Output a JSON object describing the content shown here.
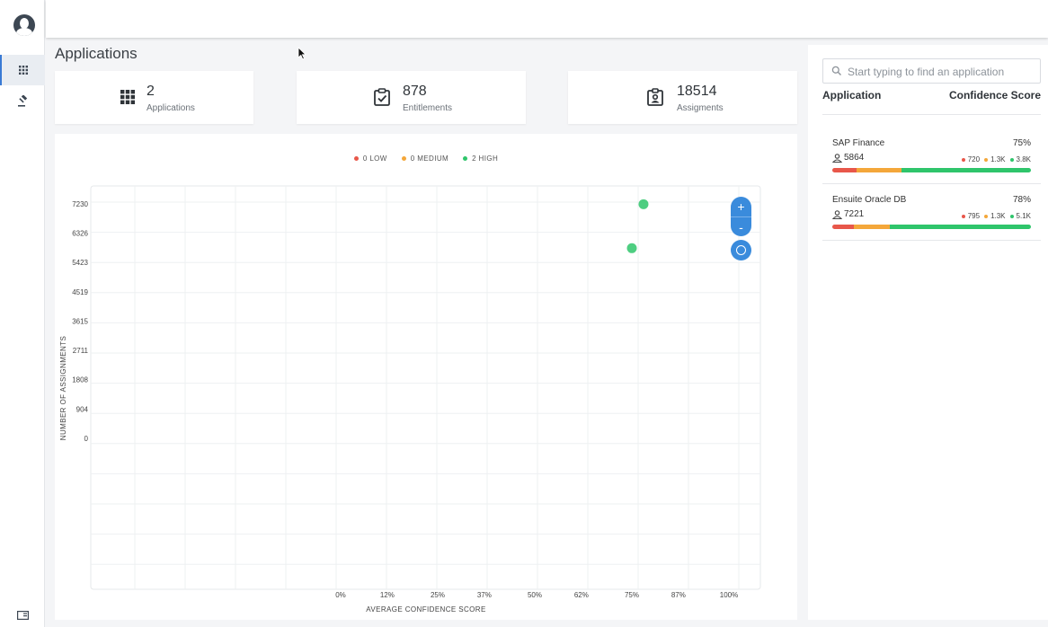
{
  "colors": {
    "low": "#e8574a",
    "medium": "#f4a73a",
    "high": "#2fc56b",
    "accent": "#3a8bdc"
  },
  "nav": {
    "items": [
      {
        "icon": "grid-icon"
      },
      {
        "icon": "gavel-icon"
      }
    ],
    "bottom_icon": "panel-toggle-icon"
  },
  "page": {
    "title": "Applications"
  },
  "stats": [
    {
      "icon": "grid-icon",
      "value": "2",
      "label": "Applications"
    },
    {
      "icon": "checklist-icon",
      "value": "878",
      "label": "Entitlements"
    },
    {
      "icon": "badge-icon",
      "value": "18514",
      "label": "Assigments"
    }
  ],
  "chart_data": {
    "type": "scatter",
    "xlabel": "AVERAGE CONFIDENCE SCORE",
    "ylabel": "NUMBER OF ASSIGNMENTS",
    "x_ticks": [
      "0%",
      "12%",
      "25%",
      "37%",
      "50%",
      "62%",
      "75%",
      "87%",
      "100%"
    ],
    "y_ticks": [
      "0",
      "904",
      "1808",
      "2711",
      "3615",
      "4519",
      "5423",
      "6326",
      "7230"
    ],
    "xlim": [
      0,
      100
    ],
    "ylim": [
      0,
      7230
    ],
    "grid": true,
    "legend_position": "top-center",
    "legend": [
      {
        "label": "0 LOW",
        "color": "#e8574a"
      },
      {
        "label": "0 MEDIUM",
        "color": "#f4a73a"
      },
      {
        "label": "2 HIGH",
        "color": "#2fc56b"
      }
    ],
    "series": [
      {
        "color": "#2fc56b",
        "points": [
          {
            "x": 78,
            "y": 7221
          },
          {
            "x": 75,
            "y": 5864
          }
        ]
      }
    ]
  },
  "zoom": {
    "in_label": "+",
    "out_label": "-"
  },
  "sidebar": {
    "search_placeholder": "Start typing to find an application",
    "col_application": "Application",
    "col_confidence": "Confidence Score",
    "apps": [
      {
        "name": "SAP Finance",
        "score": "75%",
        "users": "5864",
        "low": "720",
        "medium": "1.3K",
        "high": "3.8K",
        "low_frac": 0.123,
        "medium_frac": 0.225,
        "high_frac": 0.652
      },
      {
        "name": "Ensuite Oracle DB",
        "score": "78%",
        "users": "7221",
        "low": "795",
        "medium": "1.3K",
        "high": "5.1K",
        "low_frac": 0.11,
        "medium_frac": 0.18,
        "high_frac": 0.71
      }
    ]
  }
}
